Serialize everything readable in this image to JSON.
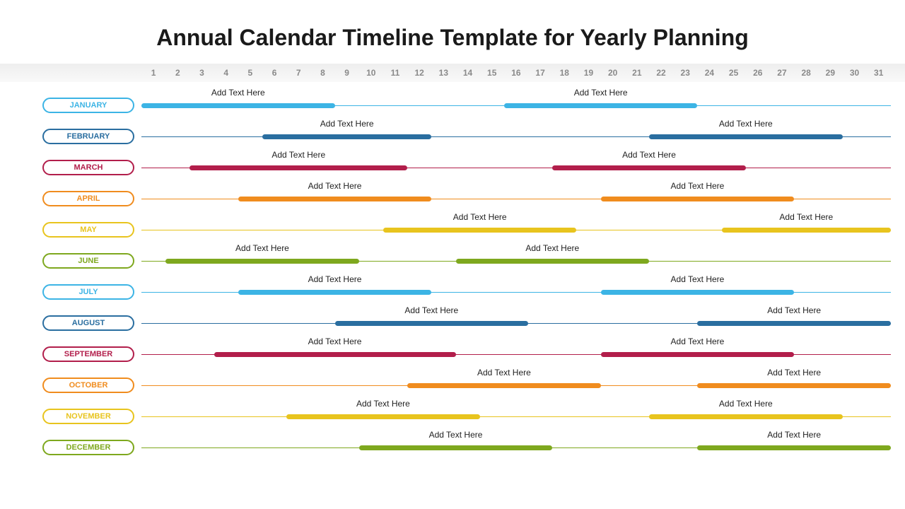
{
  "title": "Annual Calendar Timeline Template for Yearly Planning",
  "placeholder_label": "Add Text Here",
  "days": [
    1,
    2,
    3,
    4,
    5,
    6,
    7,
    8,
    9,
    10,
    11,
    12,
    13,
    14,
    15,
    16,
    17,
    18,
    19,
    20,
    21,
    22,
    23,
    24,
    25,
    26,
    27,
    28,
    29,
    30,
    31
  ],
  "months": [
    {
      "name": "JANUARY",
      "color": "#3cb4e5",
      "bars": [
        {
          "start": 1,
          "end": 8
        },
        {
          "start": 16,
          "end": 23
        }
      ]
    },
    {
      "name": "FEBRUARY",
      "color": "#2a6ea0",
      "bars": [
        {
          "start": 6,
          "end": 12
        },
        {
          "start": 22,
          "end": 29
        }
      ]
    },
    {
      "name": "MARCH",
      "color": "#b21e4b",
      "bars": [
        {
          "start": 3,
          "end": 11
        },
        {
          "start": 18,
          "end": 25
        }
      ]
    },
    {
      "name": "APRIL",
      "color": "#f08c1e",
      "bars": [
        {
          "start": 5,
          "end": 12
        },
        {
          "start": 20,
          "end": 27
        }
      ]
    },
    {
      "name": "MAY",
      "color": "#e8c41e",
      "bars": [
        {
          "start": 11,
          "end": 18
        },
        {
          "start": 25,
          "end": 31
        }
      ]
    },
    {
      "name": "JUNE",
      "color": "#7ea81e",
      "bars": [
        {
          "start": 2,
          "end": 9
        },
        {
          "start": 14,
          "end": 21
        }
      ]
    },
    {
      "name": "JULY",
      "color": "#3cb4e5",
      "bars": [
        {
          "start": 5,
          "end": 12
        },
        {
          "start": 20,
          "end": 27
        }
      ]
    },
    {
      "name": "AUGUST",
      "color": "#2a6ea0",
      "bars": [
        {
          "start": 9,
          "end": 16
        },
        {
          "start": 24,
          "end": 31
        }
      ]
    },
    {
      "name": "SEPTEMBER",
      "color": "#b21e4b",
      "bars": [
        {
          "start": 4,
          "end": 13
        },
        {
          "start": 20,
          "end": 27
        }
      ]
    },
    {
      "name": "OCTOBER",
      "color": "#f08c1e",
      "bars": [
        {
          "start": 12,
          "end": 19
        },
        {
          "start": 24,
          "end": 31
        }
      ]
    },
    {
      "name": "NOVEMBER",
      "color": "#e8c41e",
      "bars": [
        {
          "start": 7,
          "end": 14
        },
        {
          "start": 22,
          "end": 29
        }
      ]
    },
    {
      "name": "DECEMBER",
      "color": "#7ea81e",
      "bars": [
        {
          "start": 10,
          "end": 17
        },
        {
          "start": 24,
          "end": 31
        }
      ]
    }
  ]
}
